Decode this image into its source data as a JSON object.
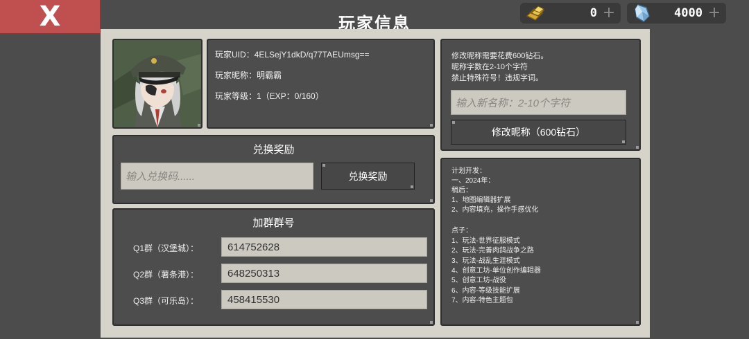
{
  "close_button": {
    "label": "X"
  },
  "header": {
    "title": "玩家信息"
  },
  "currencies": {
    "gold": {
      "icon": "gold-bar-icon",
      "value": "0",
      "plus": "+"
    },
    "gem": {
      "icon": "diamond-icon",
      "value": "4000",
      "plus": "+"
    }
  },
  "player": {
    "avatar_icon": "officer-portrait",
    "uid": "玩家UID：4ELSejY1dkD/q77TAEUmsg==",
    "nickname": "玩家昵称：明霸霸",
    "level": "玩家等级：1（EXP：0/160）"
  },
  "redeem": {
    "title": "兑换奖励",
    "placeholder": "输入兑换码......",
    "button_label": "兑换奖励"
  },
  "groups": {
    "title": "加群群号",
    "items": [
      {
        "label": "Q1群（汉堡城）：",
        "value": "614752628"
      },
      {
        "label": "Q2群（薯条港）：",
        "value": "648250313"
      },
      {
        "label": "Q3群（可乐岛）：",
        "value": "458415530"
      }
    ]
  },
  "rename": {
    "lines": [
      "修改昵称需要花费600钻石。",
      "昵称字数在2-10个字符",
      "禁止特殊符号！违规字词。"
    ],
    "placeholder": "输入新名称：2-10个字符",
    "button_label": "修改昵称（600钻石）"
  },
  "development": {
    "lines": [
      "计划开发：",
      "一、2024年：",
      "稍后：",
      "1、地图编辑器扩展",
      "2、内容填充，操作手感优化",
      "",
      "点子：",
      "1、玩法-世界征服模式",
      "2、玩法-完善肉鸽战争之路",
      "3、玩法-战乱生涯模式",
      "4、创意工坊-单位创作编辑器",
      "5、创意工坊-战役",
      "6、内容-等级技能扩展",
      "7、内容-特色主题包"
    ]
  }
}
